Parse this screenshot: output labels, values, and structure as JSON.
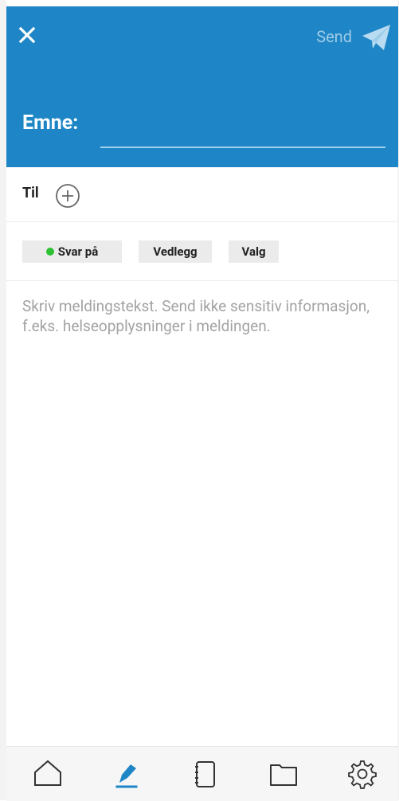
{
  "header": {
    "close_icon": "close-icon",
    "send_label": "Send",
    "send_icon": "paper-plane-icon",
    "subject_label": "Emne:",
    "subject_value": ""
  },
  "recipients": {
    "to_label": "Til",
    "add_icon": "plus-circle-icon"
  },
  "chips": {
    "reply_label": "Svar på",
    "attach_label": "Vedlegg",
    "options_label": "Valg",
    "reply_status_color": "#2fc134"
  },
  "message": {
    "placeholder": "Skriv meldingstekst. Send ikke sensitiv informasjon, f.eks. helseopplysninger i meldingen."
  },
  "bottom_nav": {
    "items": [
      {
        "icon": "home-icon"
      },
      {
        "icon": "pen-icon",
        "active": true
      },
      {
        "icon": "notebook-icon"
      },
      {
        "icon": "folder-icon"
      },
      {
        "icon": "gear-icon"
      }
    ]
  },
  "colors": {
    "header_bg": "#1e86c6",
    "accent": "#1e86c6",
    "placeholder": "#a3a3a3"
  }
}
